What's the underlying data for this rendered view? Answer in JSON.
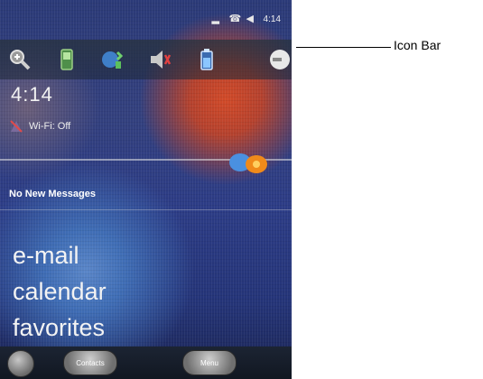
{
  "status_bar": {
    "icons": [
      "signal-icon",
      "phone-icon",
      "volume-icon",
      "battery-icon"
    ],
    "clock": "4:14"
  },
  "icon_bar": {
    "icons": [
      "search-zoom-icon",
      "phone-signal-icon",
      "wireless-icon",
      "speaker-icon",
      "battery-icon",
      "circle-icon"
    ]
  },
  "today": {
    "time": "4:14 ",
    "wifi_status": "Wi-Fi: Off",
    "messages": "No New Messages"
  },
  "menu": {
    "items": [
      "e-mail",
      "calendar",
      "favorites"
    ]
  },
  "soft_bar": {
    "left_key": "Contacts",
    "right_key": "Menu"
  },
  "callout": {
    "label": "Icon Bar"
  },
  "colors": {
    "wallpaper_blue": "#2c3c86",
    "wallpaper_orange": "#d24a28",
    "text_light": "#f3f3f3"
  }
}
